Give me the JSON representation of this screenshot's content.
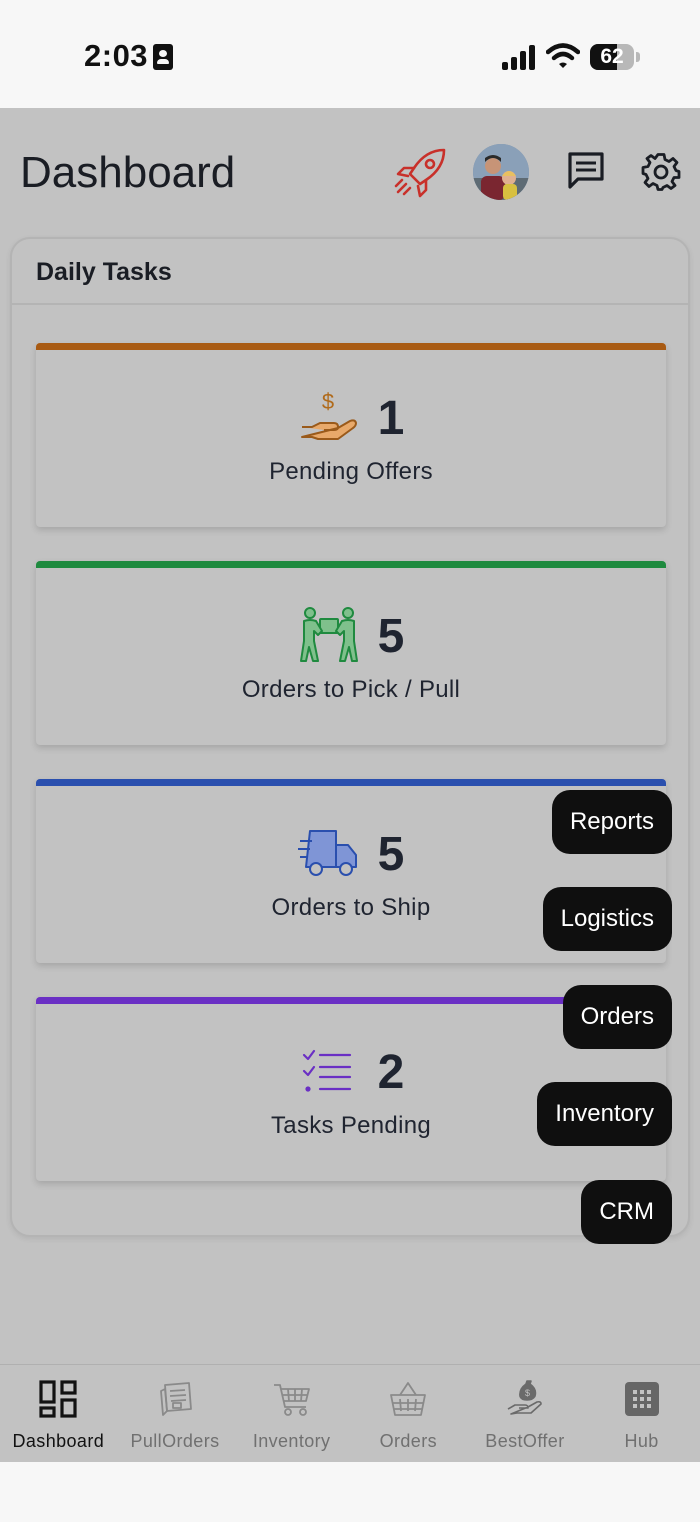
{
  "status_bar": {
    "time": "2:03",
    "battery": "62",
    "battery_level": 0.62
  },
  "header": {
    "title": "Dashboard",
    "icons": [
      "rocket-icon",
      "avatar",
      "chat-icon",
      "gear-icon"
    ]
  },
  "daily_tasks": {
    "title": "Daily Tasks",
    "items": [
      {
        "count": "1",
        "label": "Pending Offers",
        "color": "#a85a12",
        "icon": "hand-dollar-icon"
      },
      {
        "count": "5",
        "label": "Orders to Pick / Pull",
        "color": "#1f8a3f",
        "icon": "people-carry-icon"
      },
      {
        "count": "5",
        "label": "Orders to Ship",
        "color": "#2a4fae",
        "icon": "truck-icon"
      },
      {
        "count": "2",
        "label": "Tasks Pending",
        "color": "#6a2fc4",
        "icon": "checklist-icon"
      }
    ]
  },
  "quick_menu": {
    "items": [
      "Reports",
      "Logistics",
      "Orders",
      "Inventory",
      "CRM"
    ]
  },
  "tabbar": {
    "items": [
      {
        "label": "Dashboard",
        "icon": "dashboard-icon",
        "active": true
      },
      {
        "label": "PullOrders",
        "icon": "pull-orders-icon",
        "active": false
      },
      {
        "label": "Inventory",
        "icon": "cart-icon",
        "active": false
      },
      {
        "label": "Orders",
        "icon": "basket-icon",
        "active": false
      },
      {
        "label": "BestOffer",
        "icon": "hand-money-bag-icon",
        "active": false
      },
      {
        "label": "Hub",
        "icon": "grid-icon",
        "active": false
      }
    ]
  },
  "colors": {
    "overlay_bg": "#c2c2c2",
    "fab_bg": "#0f0f0f",
    "rocket": "#c8302a"
  }
}
